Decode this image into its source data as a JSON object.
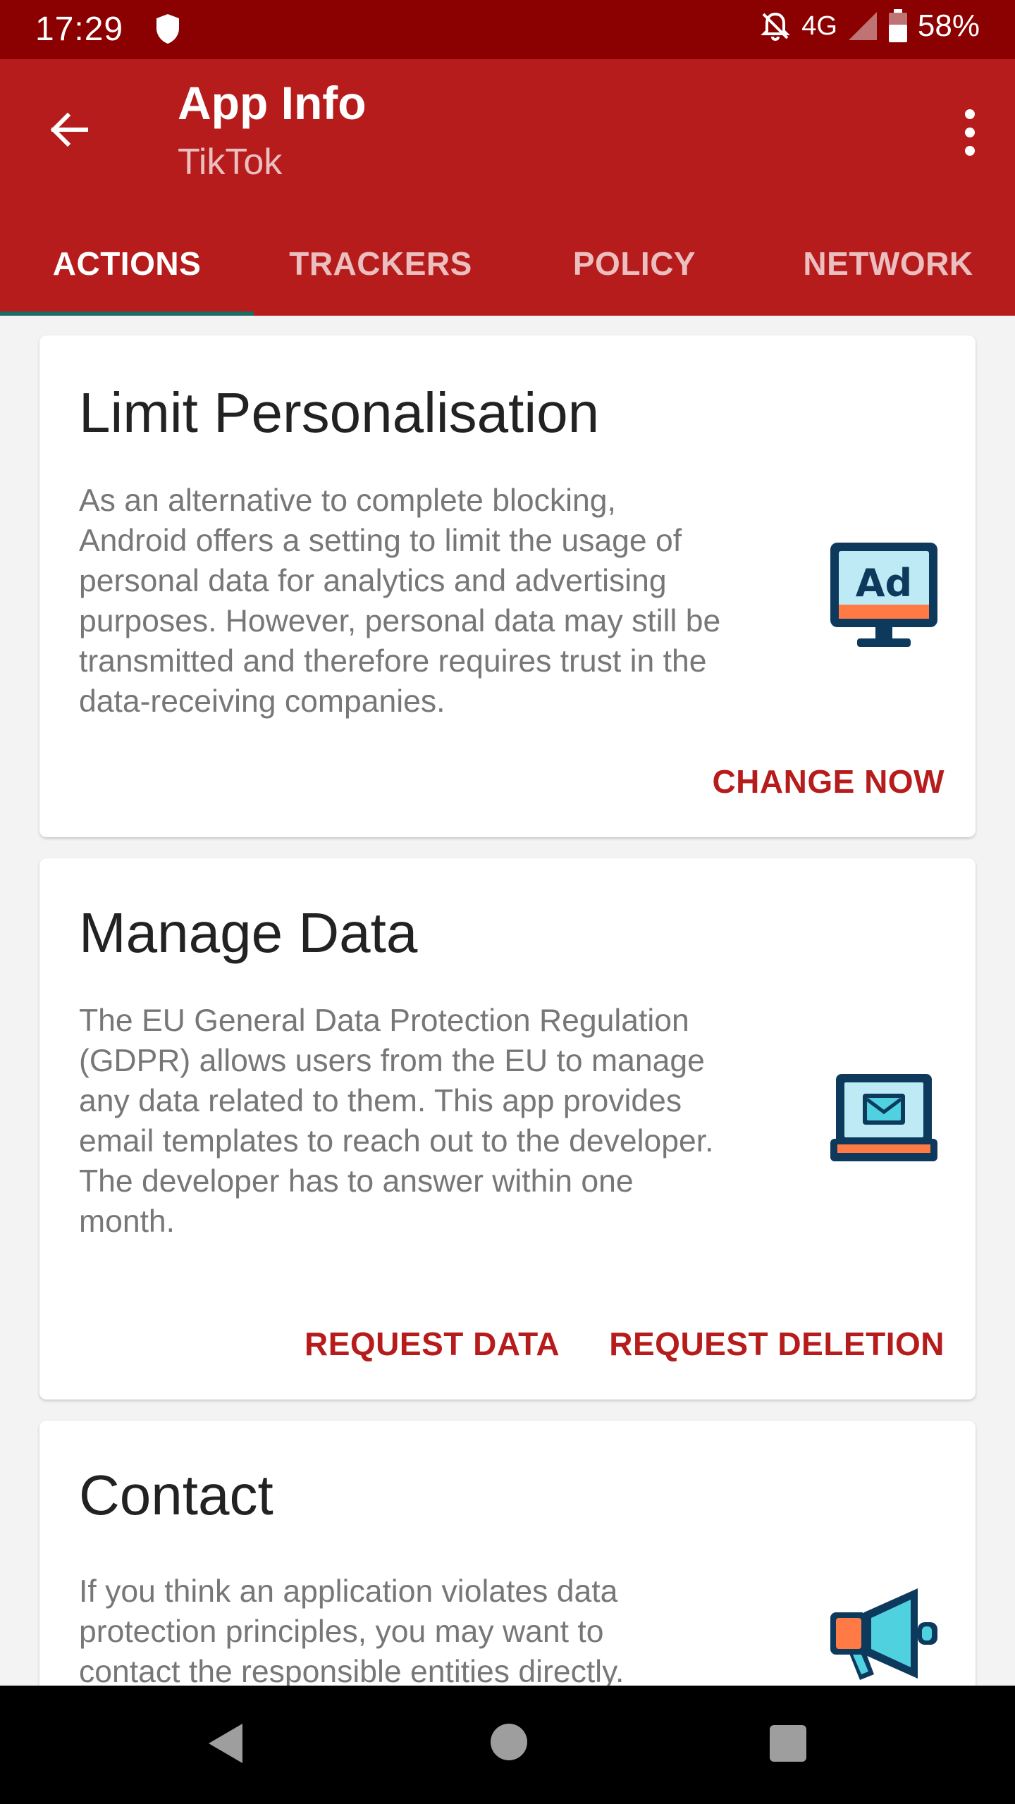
{
  "status_bar": {
    "time": "17:29",
    "network": "4G",
    "battery": "58%",
    "icons": [
      "shield-icon",
      "bell-off-icon",
      "signal-icon",
      "battery-icon"
    ]
  },
  "toolbar": {
    "title": "App Info",
    "subtitle": "TikTok",
    "back_icon": "arrow-back-icon",
    "more_icon": "more-vert-icon"
  },
  "tabs": [
    {
      "label": "ACTIONS",
      "active": true
    },
    {
      "label": "TRACKERS",
      "active": false
    },
    {
      "label": "POLICY",
      "active": false
    },
    {
      "label": "NETWORK",
      "active": false
    }
  ],
  "cards": {
    "limit": {
      "title": "Limit Personalisation",
      "body_lines": [
        "As an alternative to complete blocking,",
        "Android offers a setting to limit the usage of",
        "personal data for analytics and advertising",
        "purposes. However, personal data may still be",
        "transmitted and therefore requires trust in the",
        "data-receiving companies."
      ],
      "icon": "ad-monitor-icon",
      "icon_text": "Ad",
      "action": "CHANGE NOW"
    },
    "manage": {
      "title": "Manage Data",
      "body_lines": [
        "The EU General Data Protection Regulation",
        "(GDPR) allows users from the EU to manage",
        "any data related to them. This app provides",
        "email templates to reach out to the developer.",
        "The developer has to answer within one",
        "month."
      ],
      "icon": "laptop-mail-icon",
      "actions": [
        "REQUEST DATA",
        "REQUEST DELETION"
      ]
    },
    "contact": {
      "title": "Contact",
      "body_lines": [
        "If you think an application violates data",
        "protection principles, you may want to",
        "contact the responsible entities directly."
      ],
      "icon": "megaphone-icon"
    }
  },
  "navbar": {
    "icons": [
      "nav-back-icon",
      "nav-home-icon",
      "nav-recents-icon"
    ]
  },
  "colors": {
    "status_bar": "#8b0000",
    "primary": "#b71c1c",
    "tab_indicator": "#1e6b63",
    "icon_dark": "#0d3a5c",
    "icon_orange": "#ff7a45",
    "icon_cyan": "#4fd1e0"
  }
}
